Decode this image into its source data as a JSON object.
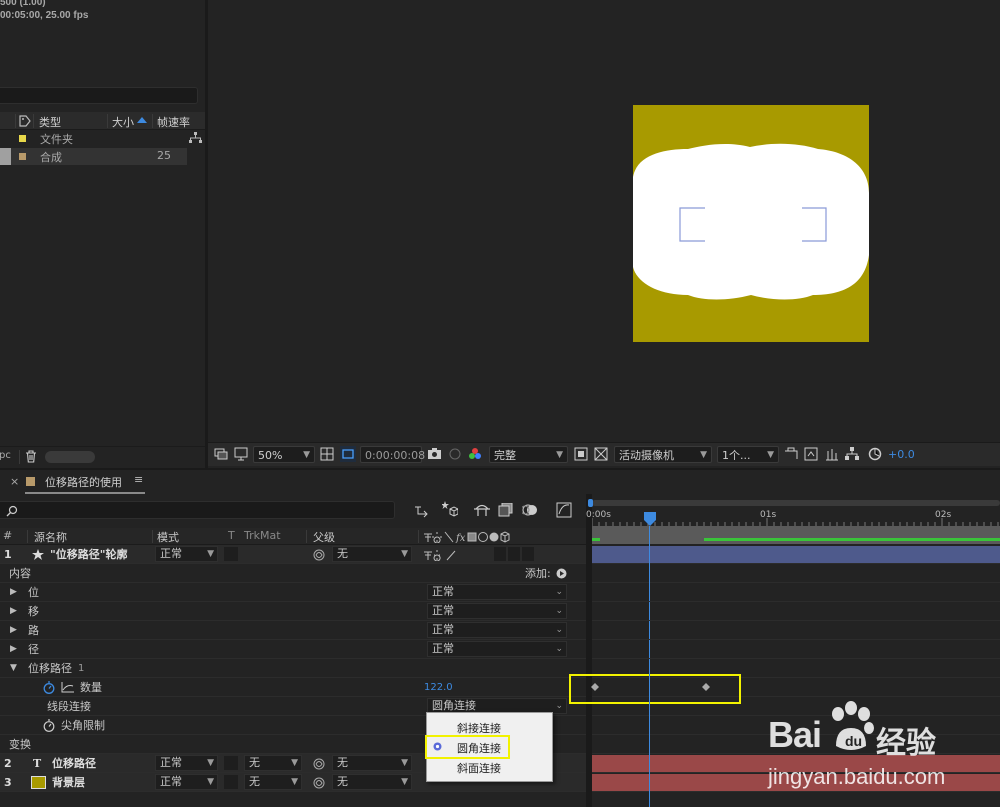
{
  "project": {
    "info_line1": "500 (1.00)",
    "info_line2": "00:05:00, 25.00 fps",
    "columns": {
      "type": "类型",
      "size": "大小",
      "fps": "帧速率"
    },
    "items": [
      {
        "name": "文件夹",
        "fps": "",
        "color": "#e8d84a"
      },
      {
        "name": "合成",
        "fps": "25",
        "color": "#b89a6a"
      }
    ],
    "bottom_label": "pc"
  },
  "composition": {
    "bg_color": "#a89a00",
    "shape_color": "#ffffff",
    "bracket_color": "#8a9ad8"
  },
  "viewer": {
    "zoom": "50%",
    "timecode": "0:00:00:08",
    "resolution": "完整",
    "camera": "活动摄像机",
    "views": "1个...",
    "exposure": "+0.0"
  },
  "timeline": {
    "tab_title": "位移路径的使用",
    "columns": {
      "num": "#",
      "source": "源名称",
      "mode": "模式",
      "t": "T",
      "trkmat": "TrkMat",
      "parent": "父级"
    },
    "ruler": {
      "t0": "0:00s",
      "t1": "01s",
      "t2": "02s"
    },
    "layers": [
      {
        "num": "1",
        "name": "\"位移路径\"轮廓",
        "mode": "正常",
        "parent": "无"
      },
      {
        "num": "2",
        "name": "位移路径",
        "mode": "正常",
        "trkmat": "无",
        "parent": "无"
      },
      {
        "num": "3",
        "name": "背景层",
        "mode": "正常",
        "trkmat": "无",
        "parent": "无"
      }
    ],
    "content_label": "内容",
    "add_label": "添加:",
    "groups": [
      {
        "name": "位",
        "mode": "正常"
      },
      {
        "name": "移",
        "mode": "正常"
      },
      {
        "name": "路",
        "mode": "正常"
      },
      {
        "name": "径",
        "mode": "正常"
      }
    ],
    "offset_paths": "位移路径",
    "offset_index": "1",
    "amount_label": "数量",
    "amount_value": "122.0",
    "join_label": "线段连接",
    "join_value": "圆角连接",
    "miter_label": "尖角限制",
    "transform_label": "变换",
    "join_menu": [
      "斜接连接",
      "圆角连接",
      "斜面连接"
    ],
    "join_menu_selected": 1
  },
  "watermark": {
    "brand": "Bai",
    "brand2": "经验",
    "url": "jingyan.baidu.com"
  }
}
